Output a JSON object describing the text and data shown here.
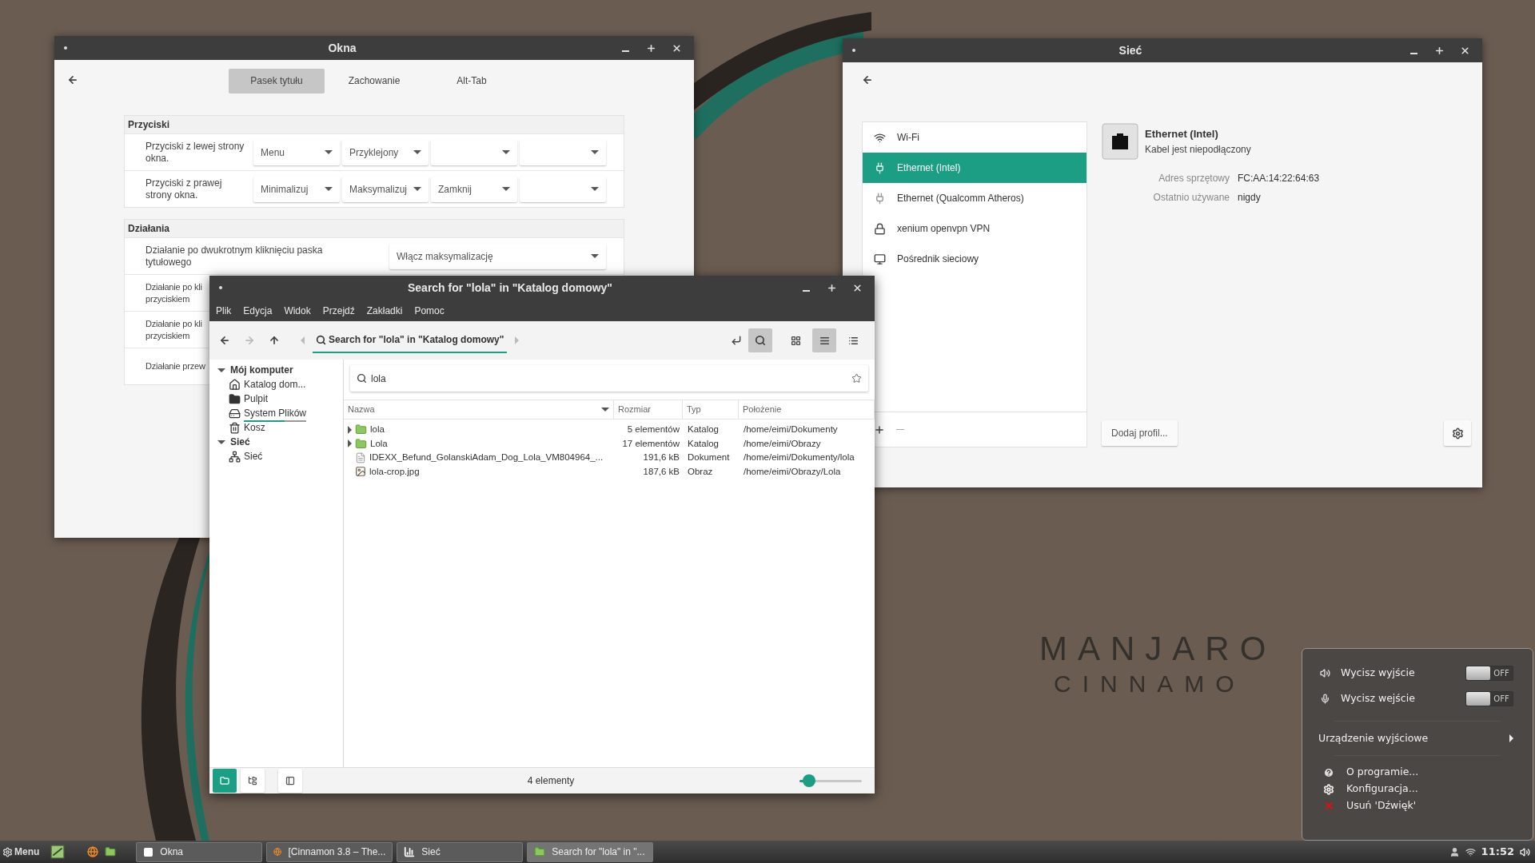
{
  "desktop_logo": {
    "line_1": "MANJARO",
    "line_2": "CINNAMO"
  },
  "okna_window": {
    "title": "Okna",
    "tabs": [
      {
        "label": "Pasek tytułu",
        "selected": true
      },
      {
        "label": "Zachowanie",
        "selected": false
      },
      {
        "label": "Alt-Tab",
        "selected": false
      }
    ],
    "sections": [
      {
        "heading": "Przyciski",
        "rows": [
          {
            "label_lines": [
              "Przyciski z lewej strony",
              "okna."
            ],
            "dropdowns": [
              {
                "kind": "value",
                "value": "Menu"
              },
              {
                "kind": "value",
                "value": "Przyklejony"
              },
              {
                "kind": "blank"
              },
              {
                "kind": "blank"
              }
            ]
          },
          {
            "label_lines": [
              "Przyciski z prawej",
              "strony okna."
            ],
            "dropdowns": [
              {
                "kind": "value",
                "value": "Minimalizuj"
              },
              {
                "kind": "value",
                "value": "Maksymalizuj"
              },
              {
                "kind": "value",
                "value": "Zamknij"
              },
              {
                "kind": "blank"
              }
            ]
          }
        ]
      },
      {
        "heading": "Działania",
        "rows": [
          {
            "label_lines": [
              "Działanie po dwukrotnym kliknięciu paska",
              "tytułowego"
            ],
            "dropdowns": [
              {
                "kind": "value",
                "value": "Włącz maksymalizację"
              }
            ]
          },
          {
            "label_lines": [
              "Działanie po kli",
              "przyciskiem"
            ]
          },
          {
            "label_lines": [
              "Działanie po kli",
              "przyciskiem"
            ]
          },
          {
            "label_lines": [
              "Działanie przew"
            ]
          }
        ]
      }
    ]
  },
  "network_window": {
    "title": "Sieć",
    "connections": [
      {
        "label": "Wi-Fi",
        "kind": "wifi",
        "selected": false
      },
      {
        "label": "Ethernet (Intel)",
        "kind": "ethernet",
        "selected": true
      },
      {
        "label": "Ethernet (Qualcomm Atheros)",
        "kind": "ethernet",
        "selected": false
      },
      {
        "label": "xenium openvpn VPN",
        "kind": "vpn",
        "selected": false
      },
      {
        "label": "Pośrednik sieciowy",
        "kind": "proxy",
        "selected": false
      }
    ],
    "detail": {
      "title": "Ethernet (Intel)",
      "subtitle": "Kabel jest niepodłączony",
      "properties": [
        {
          "label": "Adres sprzętowy",
          "value": "FC:AA:14:22:64:63"
        },
        {
          "label": "Ostatnio używane",
          "value": "nigdy"
        }
      ]
    },
    "add_profile_button": "Dodaj profil..."
  },
  "file_manager": {
    "title": "Search for \"lola\" in \"Katalog domowy\"",
    "menu": [
      "Plik",
      "Edycja",
      "Widok",
      "Przejdź",
      "Zakładki",
      "Pomoc"
    ],
    "breadcrumb": "Search for \"lola\" in \"Katalog domowy\"",
    "search_active": true,
    "views": [
      {
        "kind": "icons",
        "selected": false
      },
      {
        "kind": "list",
        "selected": true
      },
      {
        "kind": "compact",
        "selected": false
      }
    ],
    "sidebar": [
      {
        "label": "Mój komputer",
        "expanded": true,
        "children": [
          {
            "label": "Katalog dom...",
            "kind": "home"
          },
          {
            "label": "Pulpit",
            "kind": "folder"
          },
          {
            "label": "System Plików",
            "kind": "drive",
            "level": 0.65
          },
          {
            "label": "Kosz",
            "kind": "trash"
          }
        ]
      },
      {
        "label": "Sieć",
        "expanded": true,
        "children": [
          {
            "label": "Sieć",
            "kind": "network"
          }
        ]
      }
    ],
    "search_value": "lola",
    "columns": [
      "Nazwa",
      "Rozmiar",
      "Typ",
      "Położenie"
    ],
    "rows": [
      {
        "kind": "folder",
        "name": "lola",
        "size": "5 elementów",
        "type": "Katalog",
        "location": "/home/eimi/Dokumenty"
      },
      {
        "kind": "folder",
        "name": "Lola",
        "size": "17 elementów",
        "type": "Katalog",
        "location": "/home/eimi/Obrazy"
      },
      {
        "kind": "document",
        "name": "IDEXX_Befund_GolanskiAdam_Dog_Lola_VM804964_...",
        "size": "191,6 kB",
        "type": "Dokument",
        "location": "/home/eimi/Dokumenty/lola"
      },
      {
        "kind": "image",
        "name": "lola-crop.jpg",
        "size": "187,6 kB",
        "type": "Obraz",
        "location": "/home/eimi/Obrazy/Lola"
      }
    ],
    "sidebar_modes": [
      {
        "kind": "places",
        "selected": true
      },
      {
        "kind": "tree",
        "selected": false
      }
    ],
    "status": "4 elementy",
    "zoom": {
      "level": 0.15
    }
  },
  "sound_menu": {
    "toggles": [
      {
        "label": "Wycisz wyjście",
        "kind": "speaker",
        "on": false,
        "state_label": "OFF"
      },
      {
        "label": "Wycisz wejście",
        "kind": "microphone",
        "on": false,
        "state_label": "OFF"
      }
    ],
    "submenu": "Urządzenie wyjściowe",
    "items": [
      {
        "label": "O programie...",
        "kind": "help"
      },
      {
        "label": "Konfiguracja...",
        "kind": "settings"
      },
      {
        "label": "Usuń 'Dźwięk'",
        "kind": "remove"
      }
    ]
  },
  "taskbar": {
    "menu_label": "Menu",
    "launchers": [
      {
        "kind": "image"
      },
      {
        "kind": "browser"
      },
      {
        "kind": "folder"
      }
    ],
    "tasks": [
      {
        "label": "Okna",
        "kind": "window",
        "selected": false
      },
      {
        "label": "[Cinnamon 3.8 – The...",
        "kind": "browser",
        "selected": false
      },
      {
        "label": "Sieć",
        "kind": "network",
        "selected": false
      },
      {
        "label": "Search for \"lola\" in \"...",
        "kind": "folder",
        "selected": true
      }
    ],
    "clock": "11:52"
  }
}
